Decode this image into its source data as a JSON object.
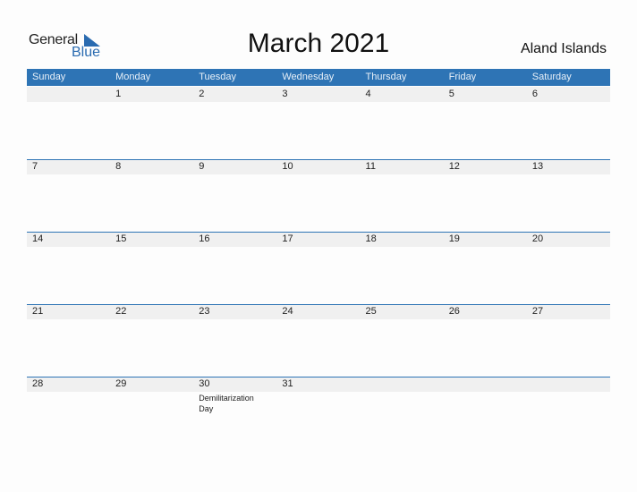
{
  "logo": {
    "line1": "General",
    "line2": "Blue"
  },
  "title": "March 2021",
  "region": "Aland Islands",
  "colors": {
    "accent": "#2e74b5",
    "strip": "#f0f0f0"
  },
  "weekdays": [
    "Sunday",
    "Monday",
    "Tuesday",
    "Wednesday",
    "Thursday",
    "Friday",
    "Saturday"
  ],
  "weeks": [
    [
      {
        "d": ""
      },
      {
        "d": "1"
      },
      {
        "d": "2"
      },
      {
        "d": "3"
      },
      {
        "d": "4"
      },
      {
        "d": "5"
      },
      {
        "d": "6"
      }
    ],
    [
      {
        "d": "7"
      },
      {
        "d": "8"
      },
      {
        "d": "9"
      },
      {
        "d": "10"
      },
      {
        "d": "11"
      },
      {
        "d": "12"
      },
      {
        "d": "13"
      }
    ],
    [
      {
        "d": "14"
      },
      {
        "d": "15"
      },
      {
        "d": "16"
      },
      {
        "d": "17"
      },
      {
        "d": "18"
      },
      {
        "d": "19"
      },
      {
        "d": "20"
      }
    ],
    [
      {
        "d": "21"
      },
      {
        "d": "22"
      },
      {
        "d": "23"
      },
      {
        "d": "24"
      },
      {
        "d": "25"
      },
      {
        "d": "26"
      },
      {
        "d": "27"
      }
    ],
    [
      {
        "d": "28"
      },
      {
        "d": "29"
      },
      {
        "d": "30",
        "event": "Demilitarization Day"
      },
      {
        "d": "31"
      },
      {
        "d": ""
      },
      {
        "d": ""
      },
      {
        "d": ""
      }
    ]
  ]
}
